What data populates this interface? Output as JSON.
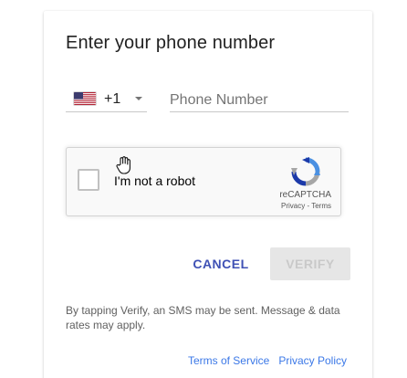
{
  "dialog": {
    "title": "Enter your phone number"
  },
  "phone": {
    "country_flag": "us-flag-icon",
    "dial_code": "+1",
    "placeholder": "Phone Number",
    "value": ""
  },
  "recaptcha": {
    "label": "I'm not a robot",
    "brand": "reCAPTCHA",
    "privacy_link": "Privacy",
    "separator": " - ",
    "terms_link": "Terms",
    "checked": false
  },
  "actions": {
    "cancel_label": "CANCEL",
    "verify_label": "VERIFY",
    "verify_enabled": false
  },
  "disclaimer": "By tapping Verify, an SMS may be sent. Message & data rates may apply.",
  "footer": {
    "terms_label": "Terms of Service",
    "privacy_label": "Privacy Policy"
  },
  "colors": {
    "accent": "#3f51b5",
    "link": "#3b78e7",
    "verify_disabled_bg": "#e6e6e6",
    "verify_disabled_text": "#c9c9c9"
  },
  "cursor": "hand-cursor-icon"
}
